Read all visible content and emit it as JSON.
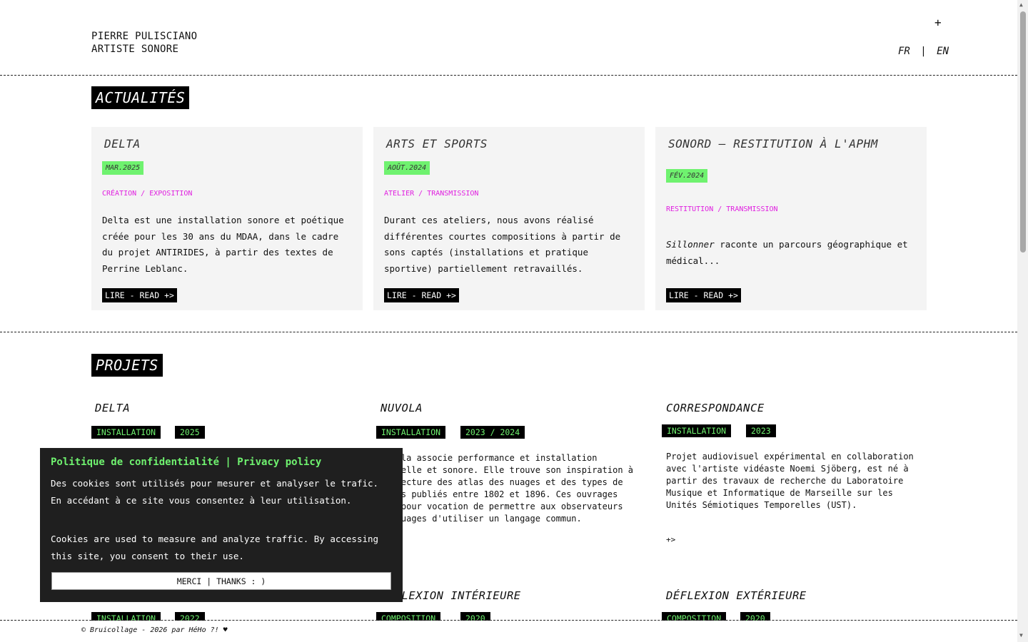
{
  "header": {
    "name_line1": "PIERRE PULISCIANO",
    "name_line2": "ARTISTE SONORE",
    "plus": "+",
    "lang_fr": "FR",
    "lang_sep": "|",
    "lang_en": "EN"
  },
  "news": {
    "title": "ACTUALITÉS",
    "read_label": "LIRE - READ +>",
    "items": [
      {
        "title": "DELTA",
        "date": "MAR.2025",
        "category": "CRÉATION / EXPOSITION",
        "text": "Delta est une installation sonore et poétique créée pour les 30 ans du MDAA, dans le cadre du projet ANTIRIDES, à partir des textes de Perrine Leblanc."
      },
      {
        "title": "ARTS ET SPORTS",
        "date": "AOÛT.2024",
        "category": "ATELIER / TRANSMISSION",
        "text": "Durant ces ateliers, nous avons réalisé différentes courtes compositions à partir de sons captés (installations et pratique sportive) partiellement retravaillés."
      },
      {
        "title": "SONORD – RESTITUTION À L'APHM",
        "date": "FÉV.2024",
        "category": "RESTITUTION / TRANSMISSION",
        "text_em": "Sillonner",
        "text": " raconte un parcours géographique et médical..."
      }
    ]
  },
  "projects": {
    "title": "PROJETS",
    "more": "+>",
    "items": [
      {
        "title": "DELTA",
        "type": "INSTALLATION",
        "year": "2025"
      },
      {
        "title": "NUVOLA",
        "type": "INSTALLATION",
        "year": "2023 / 2024",
        "text": "Nuvola associe performance et installation visuelle et sonore. Elle trouve son inspiration à la lecture des atlas des nuages et des types de ciels publiés entre 1802 et 1896. Ces ouvrages ont pour vocation de permettre aux observateurs de nuages d'utiliser un langage commun."
      },
      {
        "title": "CORRESPONDANCE",
        "type": "INSTALLATION",
        "year": "2023",
        "text": "Projet audiovisuel expérimental en collaboration avec l'artiste vidéaste Noemi Sjöberg, est né à partir des travaux de recherche du Laboratoire Musique et Informatique de Marseille sur les Unités Sémiotiques Temporelles (UST)."
      },
      {
        "title": "",
        "type": "INSTALLATION",
        "year": "2022"
      },
      {
        "title": "DÉFLEXION INTÉRIEURE",
        "type": "COMPOSITION",
        "year": "2020"
      },
      {
        "title": "DÉFLEXION EXTÉRIEURE",
        "type": "COMPOSITION",
        "year": "2020"
      }
    ]
  },
  "footer": {
    "text": "© Bruicollage - 2026 par HéHo ?! ♥"
  },
  "cookie": {
    "title": "Politique de confidentialité | Privacy policy",
    "text_fr": "Des cookies sont utilisés pour mesurer et analyser le trafic. En accédant à ce site vous consentez à leur utilisation.",
    "text_en": "Cookies are used to measure and analyze traffic. By accessing this site, you consent to their use.",
    "button": "MERCI | THANKS : )"
  },
  "colors": {
    "accent_green": "#6ff26f",
    "accent_magenta": "#e020e0",
    "card_bg": "#f4f4f4"
  }
}
